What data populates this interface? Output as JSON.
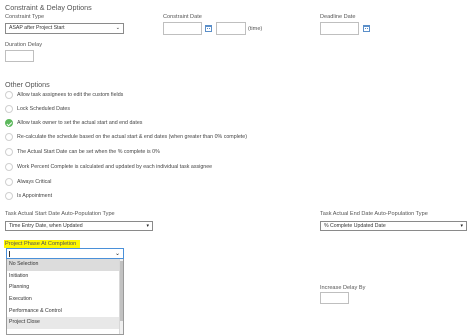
{
  "constraint_section": {
    "title": "Constraint & Delay Options",
    "constraint_type_label": "Constraint Type",
    "constraint_type_value": "ASAP after Project Start",
    "constraint_date_label": "Constraint Date",
    "constraint_time_suffix": "(time)",
    "deadline_date_label": "Deadline Date",
    "duration_delay_label": "Duration Delay"
  },
  "other_section": {
    "title": "Other Options",
    "options": [
      {
        "label": "Allow task assignees to edit the custom fields",
        "checked": false
      },
      {
        "label": "Lock Scheduled Dates",
        "checked": false
      },
      {
        "label": "Allow task owner to set the actual start and end dates",
        "checked": true
      },
      {
        "label": "Re-calculate the schedule based on the actual start & end dates (when greater than 0% complete)",
        "checked": false
      },
      {
        "label": "The Actual Start Date can be set when the % complete is 0%",
        "checked": false
      },
      {
        "label": "Work Percent Complete is calculated and updated by each individual task assignee",
        "checked": false
      },
      {
        "label": "Always Critical",
        "checked": false
      },
      {
        "label": "Is Appointment",
        "checked": false
      }
    ]
  },
  "autopop": {
    "start_label": "Task Actual Start Date Auto-Population Type",
    "start_value": "Time Entry Date, when Updated",
    "end_label": "Task Actual End Date Auto-Population Type",
    "end_value": "% Complete Updated Date"
  },
  "phase": {
    "label": "Project Phase At Completion",
    "options": [
      "No Selection",
      "Initiation",
      "Planning",
      "Execution",
      "Performance & Control",
      "Project Close"
    ],
    "selected_index": 0,
    "hover_index": 5
  },
  "increase_delay": {
    "label": "Increase Delay By"
  },
  "colors": {
    "checked_green": "#5cb85c",
    "highlight_yellow": "#fff700",
    "focus_blue": "#4a90d9"
  }
}
